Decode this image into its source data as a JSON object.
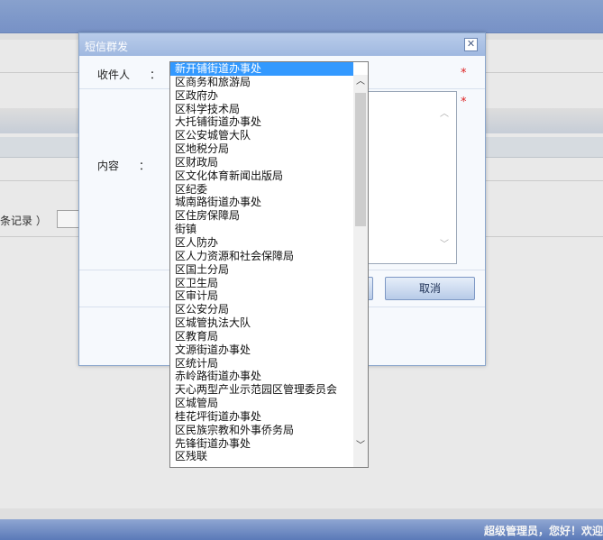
{
  "background": {
    "records_text": "条记录 ）",
    "welcome_text": "超级管理员，您好！欢迎"
  },
  "dialog": {
    "title": "短信群发",
    "close_glyph": "✕",
    "recipient_label": "收件人",
    "content_label": "内容",
    "colon": "：",
    "required_mark": "*",
    "cancel_label": "取消",
    "confirm_label": ""
  },
  "dropdown": {
    "selected": "新开铺街道办事处",
    "options": [
      "新开铺街道办事处",
      "区商务和旅游局",
      "区政府办",
      "区科学技术局",
      "大托铺街道办事处",
      "区公安城管大队",
      "区地税分局",
      "区财政局",
      "区文化体育新闻出版局",
      "区纪委",
      "城南路街道办事处",
      "区住房保障局",
      "街镇",
      "区人防办",
      "区人力资源和社会保障局",
      "区国土分局",
      "区卫生局",
      "区审计局",
      "区公安分局",
      "区城管执法大队",
      "区教育局",
      "文源街道办事处",
      "区统计局",
      "赤岭路街道办事处",
      "天心两型产业示范园区管理委员会",
      "区城管局",
      "桂花坪街道办事处",
      "区民族宗教和外事侨务局",
      "先锋街道办事处",
      "区残联"
    ]
  }
}
